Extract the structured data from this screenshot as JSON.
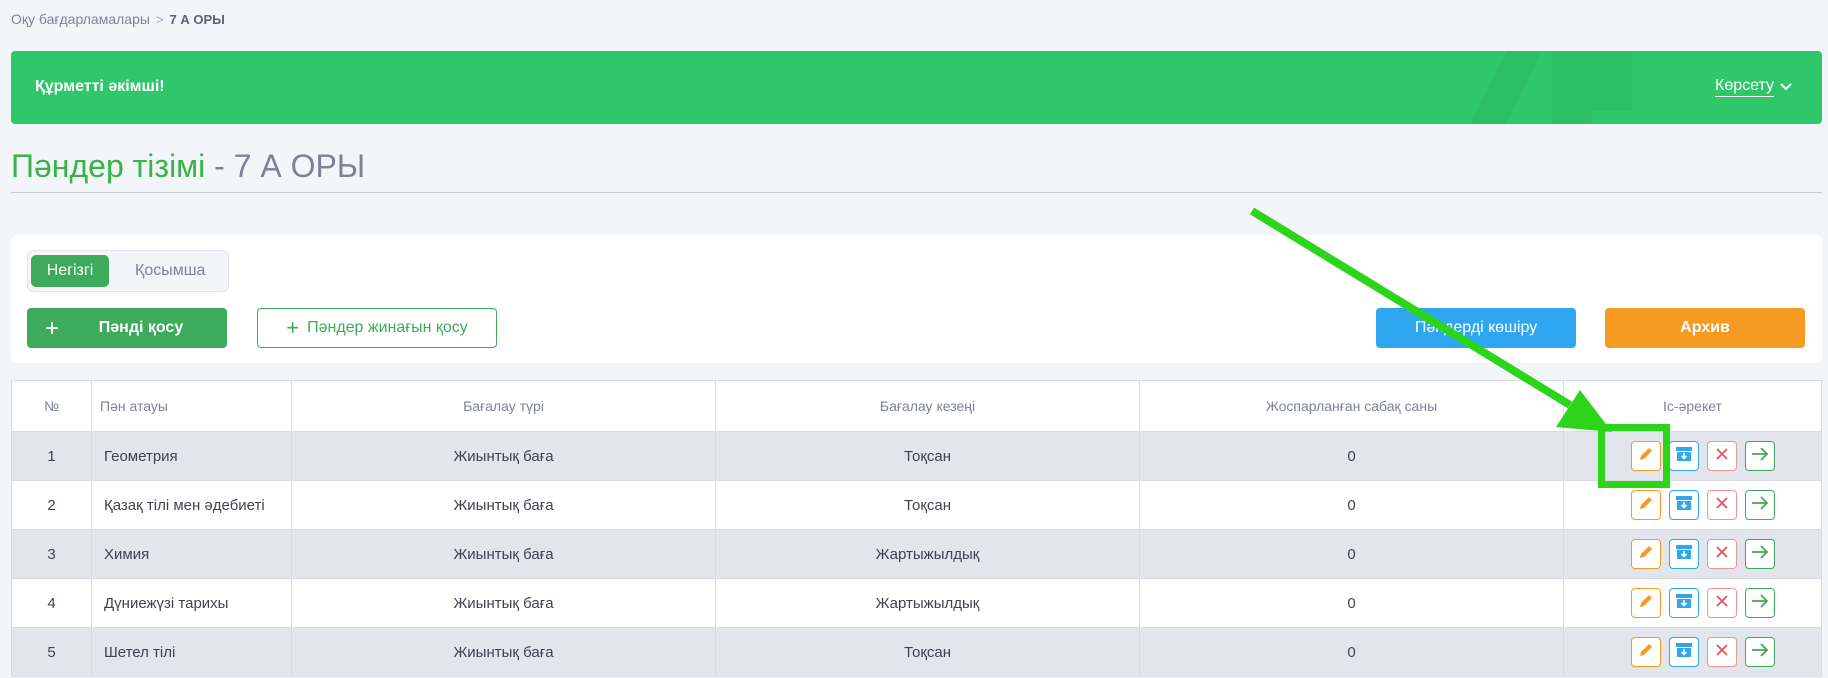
{
  "breadcrumb": {
    "parent": "Оқу бағдарламалары",
    "separator": ">",
    "current": "7 А ОРЫ"
  },
  "banner": {
    "greeting": "Құрметті әкімші!",
    "show_label": "Көрсету",
    "color": "#2ec76a"
  },
  "page": {
    "title_main": "Пәндер тізімі",
    "title_rest": " - 7 А ОРЫ"
  },
  "tabs": [
    {
      "label": "Негізгі",
      "active": true
    },
    {
      "label": "Қосымша",
      "active": false
    }
  ],
  "toolbar": {
    "add_subject": "Пәнді қосу",
    "add_subject_set": "Пәндер жинағын қосу",
    "copy_subjects": "Пәндерді көшіру",
    "archive": "Архив"
  },
  "table": {
    "headers": [
      "№",
      "Пән атауы",
      "Бағалау түрі",
      "Бағалау кезеңі",
      "Жоспарланған сабақ саны",
      "Іс-әрекет"
    ],
    "rows": [
      {
        "num": "1",
        "name": "Геометрия",
        "type": "Жиынтық баға",
        "period": "Тоқсан",
        "count": "0"
      },
      {
        "num": "2",
        "name": "Қазақ тілі мен әдебиеті",
        "type": "Жиынтық баға",
        "period": "Тоқсан",
        "count": "0"
      },
      {
        "num": "3",
        "name": "Химия",
        "type": "Жиынтық баға",
        "period": "Жартыжылдық",
        "count": "0"
      },
      {
        "num": "4",
        "name": "Дүниежүзі тарихы",
        "type": "Жиынтық баға",
        "period": "Жартыжылдық",
        "count": "0"
      },
      {
        "num": "5",
        "name": "Шетел тілі",
        "type": "Жиынтық баға",
        "period": "Тоқсан",
        "count": "0"
      }
    ]
  },
  "icons": {
    "edit": "pencil-icon",
    "archive": "archive-box-icon",
    "delete": "close-icon",
    "go": "arrow-right-icon"
  },
  "annotation": {
    "color": "#2cd41a",
    "target": "edit-button row 1"
  }
}
